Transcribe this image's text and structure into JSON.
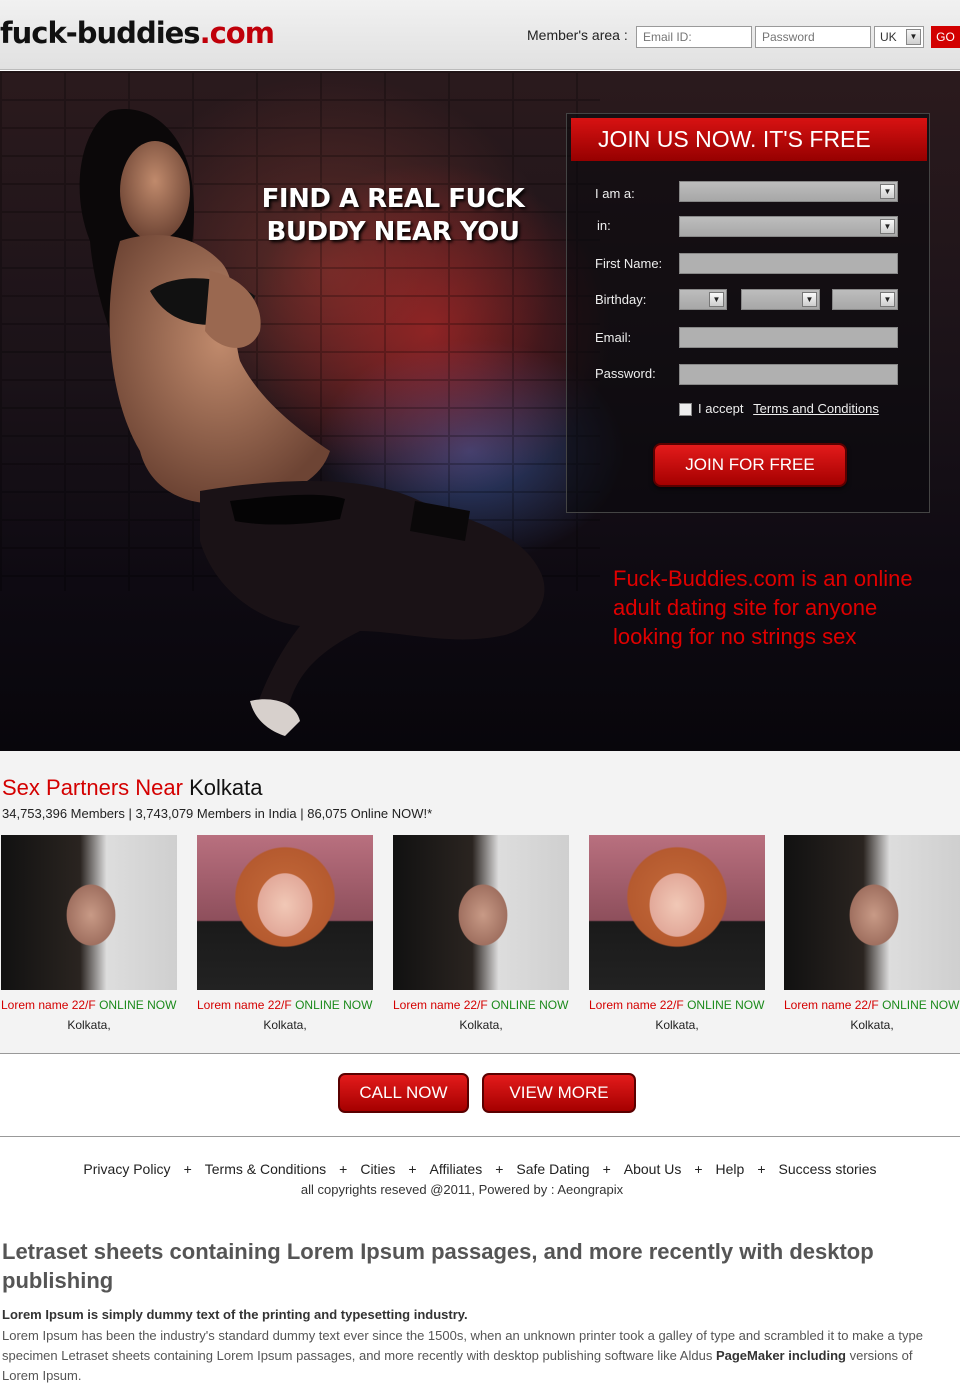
{
  "header": {
    "logo_main": "fuck-buddies",
    "logo_tld": ".com",
    "members_label": "Member's area :",
    "email_placeholder": "Email ID:",
    "password_placeholder": "Password",
    "country": "UK",
    "go_label": "GO"
  },
  "hero": {
    "headline": "FIND A REAL FUCK BUDDY NEAR YOU",
    "description": "Fuck-Buddies.com is an online adult dating site for anyone looking for no strings sex",
    "form": {
      "title": "JOIN US NOW. IT'S FREE",
      "i_am_label": "I am a:",
      "in_label": "in:",
      "first_name_label": "First Name:",
      "birthday_label": "Birthday:",
      "email_label": "Email:",
      "password_label": "Password:",
      "accept_label": "I accept",
      "terms_label": "Terms and Conditions",
      "submit_label": "JOIN FOR FREE"
    }
  },
  "members": {
    "title_red": "Sex Partners Near",
    "title_city": "Kolkata",
    "stats": "34,753,396 Members  |  3,743,079 Members in India  |  86,075 Online NOW!*",
    "cards": [
      {
        "name": "Lorem name 22/F",
        "status": "ONLINE NOW",
        "city": "Kolkata,"
      },
      {
        "name": "Lorem name 22/F",
        "status": "ONLINE NOW",
        "city": "Kolkata,"
      },
      {
        "name": "Lorem name 22/F",
        "status": "ONLINE NOW",
        "city": "Kolkata,"
      },
      {
        "name": "Lorem name 22/F",
        "status": "ONLINE NOW",
        "city": "Kolkata,"
      },
      {
        "name": "Lorem name 22/F",
        "status": "ONLINE NOW",
        "city": "Kolkata,"
      }
    ]
  },
  "actions": {
    "call_label": "CALL NOW",
    "view_label": "VIEW MORE"
  },
  "footer": {
    "links": [
      "Privacy Policy",
      "Terms & Conditions",
      "Cities",
      "Affiliates",
      "Safe Dating",
      "About Us",
      "Help",
      "Success stories"
    ],
    "separator": "+",
    "copyright": "all copyrights reseved @2011, Powered by : Aeongrapix"
  },
  "seo": {
    "title": "Letraset sheets containing Lorem Ipsum passages, and more recently with desktop publishing",
    "lead": "Lorem Ipsum is simply dummy text of the printing and typesetting industry.",
    "body_1": "Lorem Ipsum has been the industry's standard dummy text ever since the 1500s, when an unknown printer took a galley of type and scrambled it to make a type specimen Letraset sheets containing Lorem Ipsum passages, and more recently with desktop publishing software like Aldus",
    "body_bold_1": "PageMaker including",
    "body_2": "versions of Lorem Ipsum."
  }
}
